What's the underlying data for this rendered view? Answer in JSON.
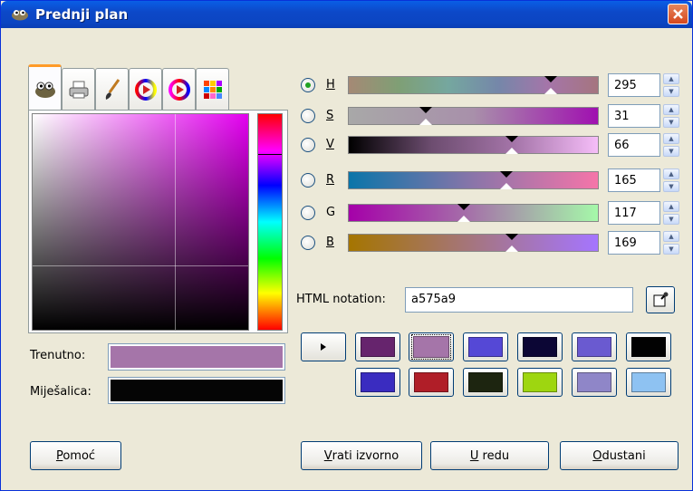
{
  "window": {
    "title": "Prednji plan"
  },
  "tabs": [
    {
      "icon": "gimp-wilber-icon",
      "active": true
    },
    {
      "icon": "printer-icon"
    },
    {
      "icon": "paintbrush-icon"
    },
    {
      "icon": "color-wheel-icon"
    },
    {
      "icon": "triangle-wheel-icon"
    },
    {
      "icon": "watercolor-grid-icon"
    }
  ],
  "colors": {
    "current": "#a575a9",
    "old": "#050505"
  },
  "labels": {
    "current": "Trenutno:",
    "old": "Miješalica:",
    "html": "HTML notation:"
  },
  "channels": [
    {
      "key": "H",
      "label": "H",
      "value": "295",
      "checked": true
    },
    {
      "key": "S",
      "label": "S",
      "value": "31"
    },
    {
      "key": "V",
      "label": "V",
      "value": "66"
    },
    {
      "key": "R",
      "label": "R",
      "value": "165"
    },
    {
      "key": "G",
      "label": "G",
      "value": "117"
    },
    {
      "key": "B",
      "label": "B",
      "value": "169"
    }
  ],
  "html_value": "a575a9",
  "history": [
    "#66246d",
    "#a575a9",
    "#5548d6",
    "#0c0635",
    "#6a5ad0",
    "#020202",
    "#3a2cc0",
    "#b01e28",
    "#1d2510",
    "#9ed610",
    "#8f86c8",
    "#8ec2f2"
  ],
  "buttons": {
    "help": "Pomoć",
    "reset": "Vrati izvorno",
    "ok": "U redu",
    "cancel": "Odustani"
  }
}
